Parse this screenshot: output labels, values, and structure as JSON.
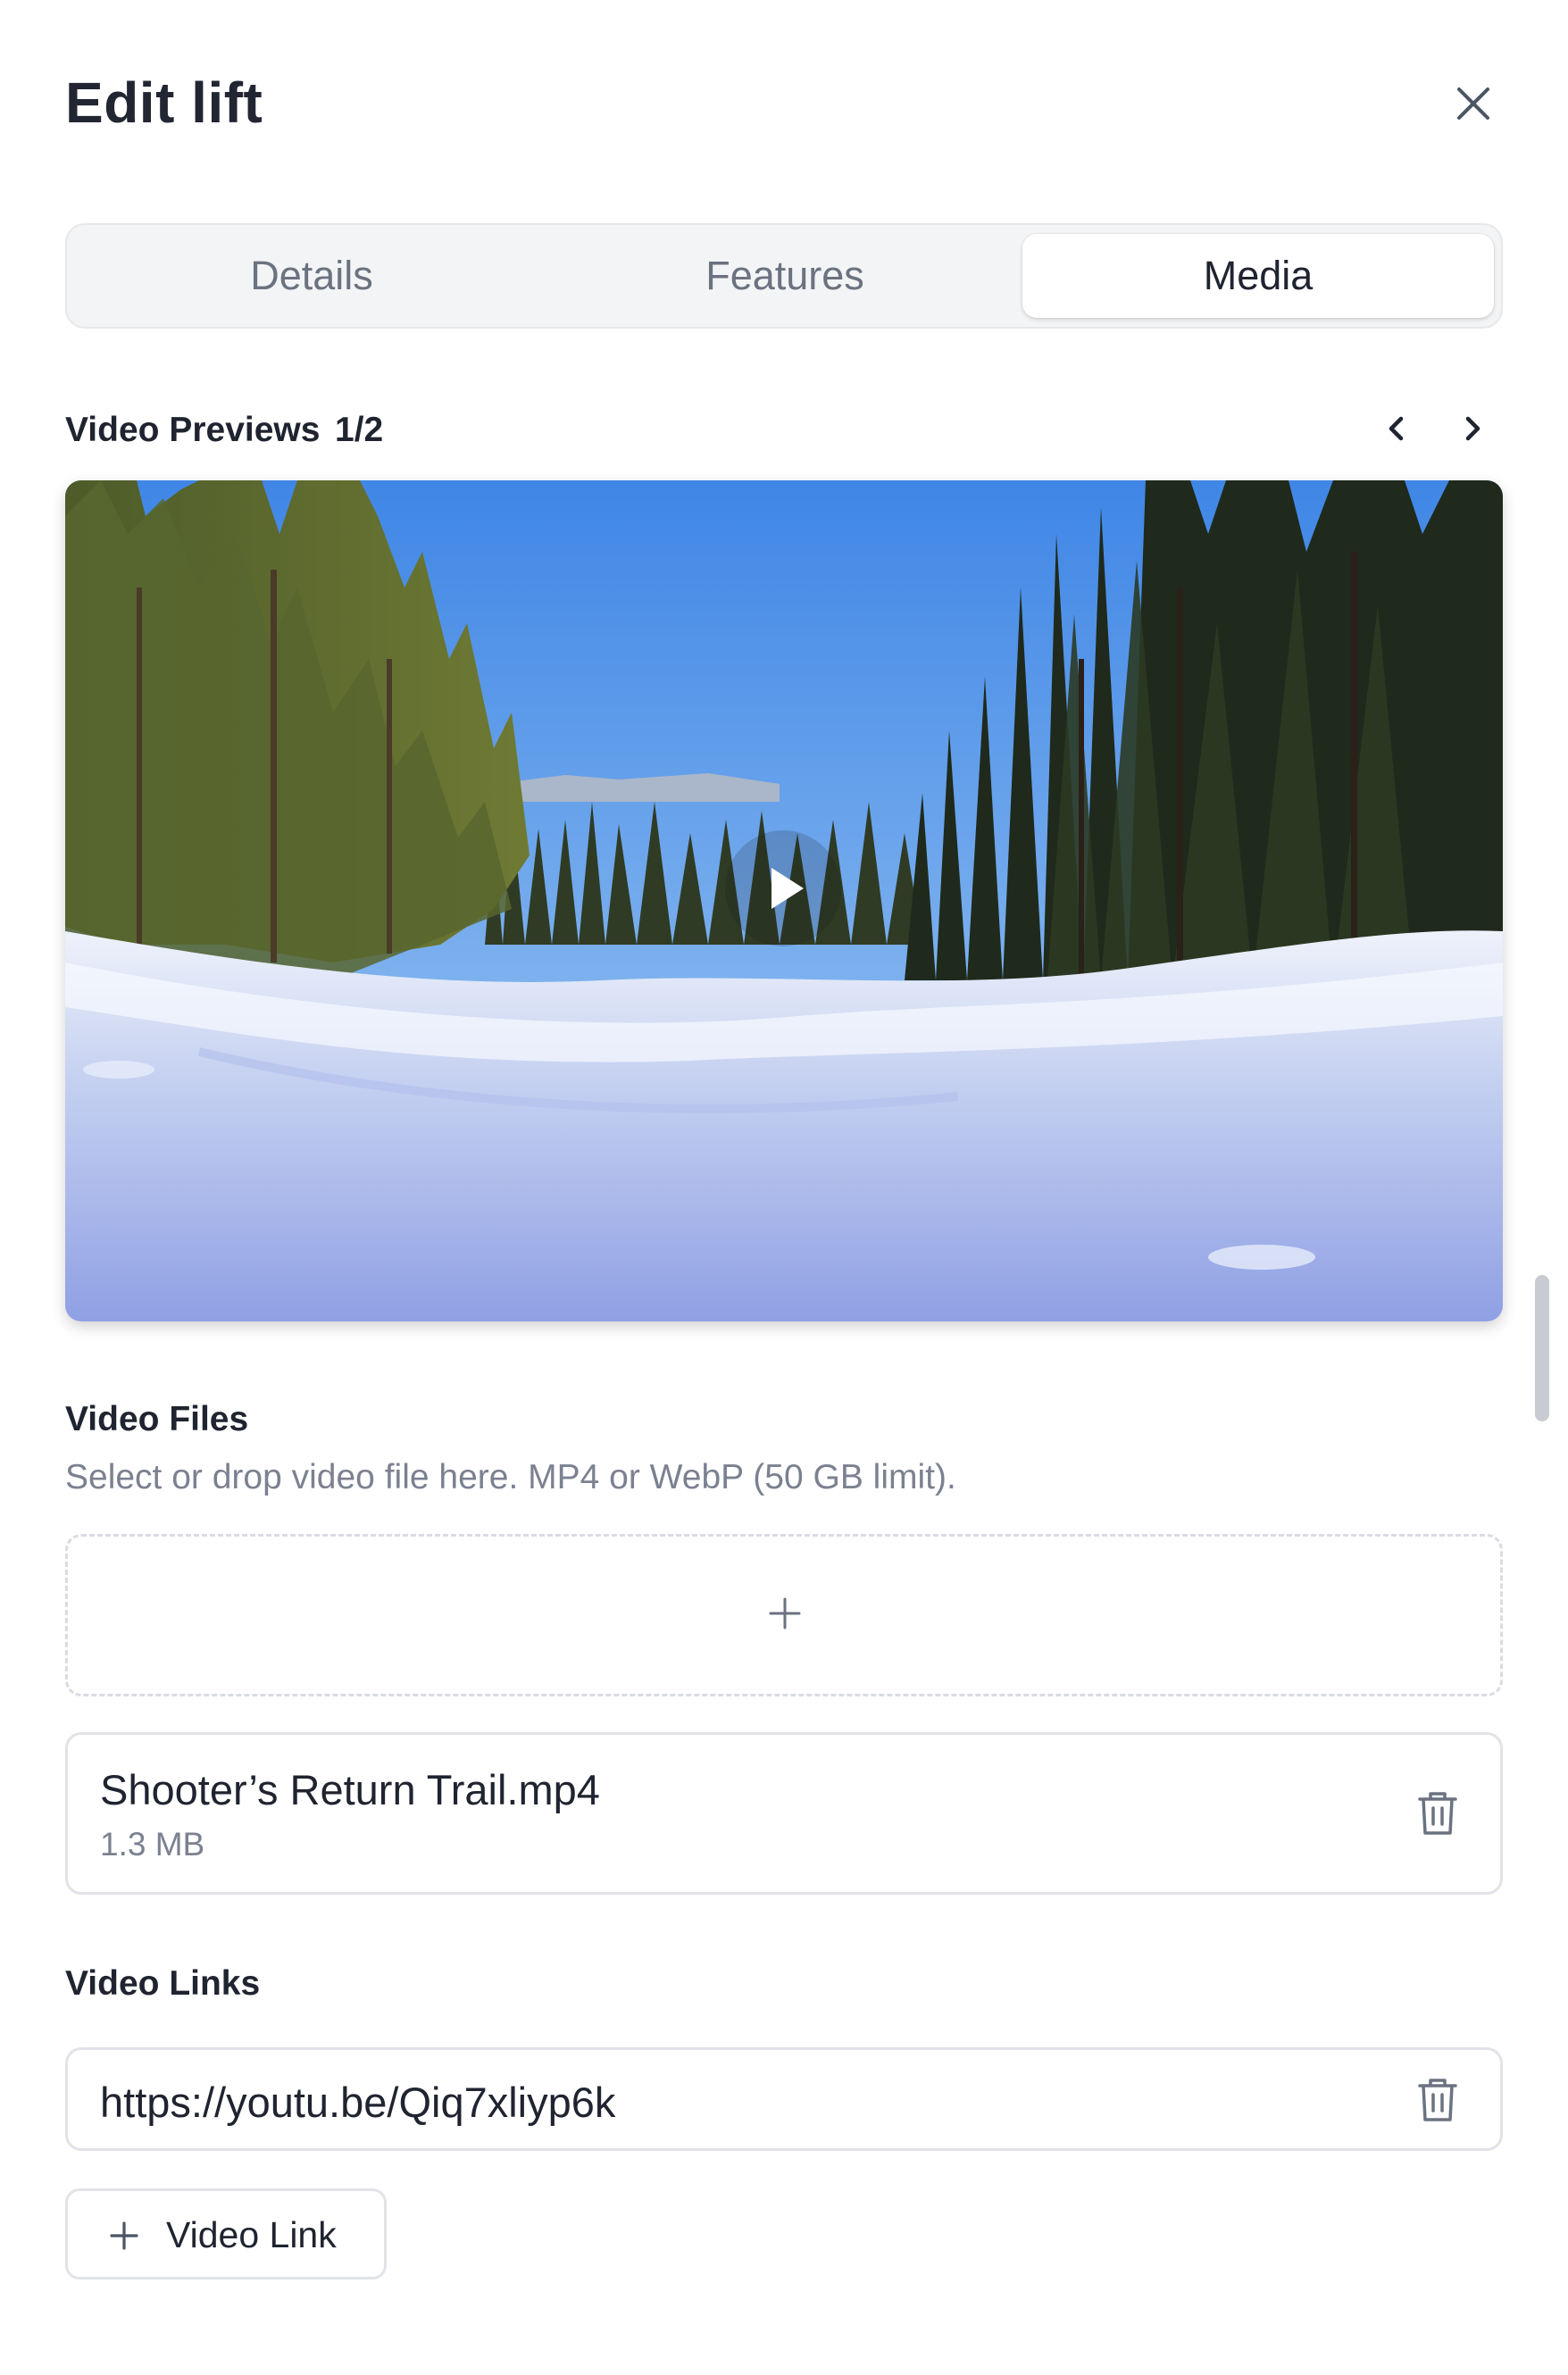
{
  "dialog": {
    "title": "Edit lift"
  },
  "tabs": [
    {
      "label": "Details",
      "active": false
    },
    {
      "label": "Features",
      "active": false
    },
    {
      "label": "Media",
      "active": true
    }
  ],
  "video_previews": {
    "label": "Video Previews",
    "counter": "1/2"
  },
  "video_files": {
    "label": "Video Files",
    "help": "Select or drop video file here. MP4 or WebP (50 GB limit).",
    "files": [
      {
        "name": "Shooter’s Return Trail.mp4",
        "size": "1.3 MB"
      }
    ]
  },
  "video_links": {
    "label": "Video Links",
    "links": [
      "https://youtu.be/Qiq7xliyp6k"
    ],
    "add_label": "Video Link"
  },
  "icons": {
    "close": "close-icon",
    "prev": "chevron-left-icon",
    "next": "chevron-right-icon",
    "play": "play-icon",
    "add": "plus-icon",
    "delete": "trash-icon"
  }
}
